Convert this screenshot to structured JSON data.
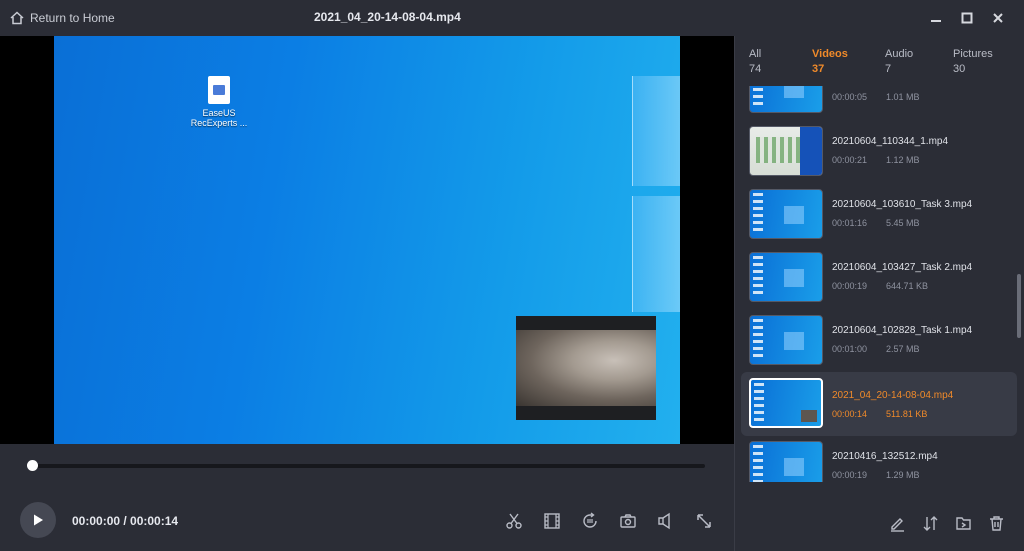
{
  "window": {
    "back_label": "Return to Home",
    "file_title": "2021_04_20-14-08-04.mp4",
    "controls": [
      "minimize-icon",
      "maximize-icon",
      "close-icon"
    ]
  },
  "video": {
    "desktop_icon_label": "EaseUS RecExperts ...",
    "progress": 0.0
  },
  "player": {
    "time_display": "00:00:00 / 00:00:14",
    "tools": [
      "trim-icon",
      "extract-frames-icon",
      "rotate-icon",
      "screenshot-icon",
      "volume-icon",
      "fullscreen-icon"
    ]
  },
  "sidebar": {
    "tabs": [
      {
        "label": "All",
        "count": "74",
        "active": false
      },
      {
        "label": "Videos",
        "count": "37",
        "active": true
      },
      {
        "label": "Audio",
        "count": "7",
        "active": false
      },
      {
        "label": "Pictures",
        "count": "30",
        "active": false
      }
    ],
    "items": [
      {
        "name": "",
        "duration": "00:00:05",
        "size": "1.01 MB",
        "selected": false
      },
      {
        "name": "20210604_110344_1.mp4",
        "duration": "00:00:21",
        "size": "1.12 MB",
        "selected": false
      },
      {
        "name": "20210604_103610_Task 3.mp4",
        "duration": "00:01:16",
        "size": "5.45 MB",
        "selected": false
      },
      {
        "name": "20210604_103427_Task 2.mp4",
        "duration": "00:00:19",
        "size": "644.71 KB",
        "selected": false
      },
      {
        "name": "20210604_102828_Task 1.mp4",
        "duration": "00:01:00",
        "size": "2.57 MB",
        "selected": false
      },
      {
        "name": "2021_04_20-14-08-04.mp4",
        "duration": "00:00:14",
        "size": "511.81 KB",
        "selected": true
      },
      {
        "name": "20210416_132512.mp4",
        "duration": "00:00:19",
        "size": "1.29 MB",
        "selected": false
      }
    ],
    "tools": [
      "rename-icon",
      "compare-icon",
      "open-folder-icon",
      "delete-icon"
    ]
  },
  "colors": {
    "accent": "#f08a2a",
    "background": "#2b2d36",
    "selected_item": "#383b46"
  }
}
